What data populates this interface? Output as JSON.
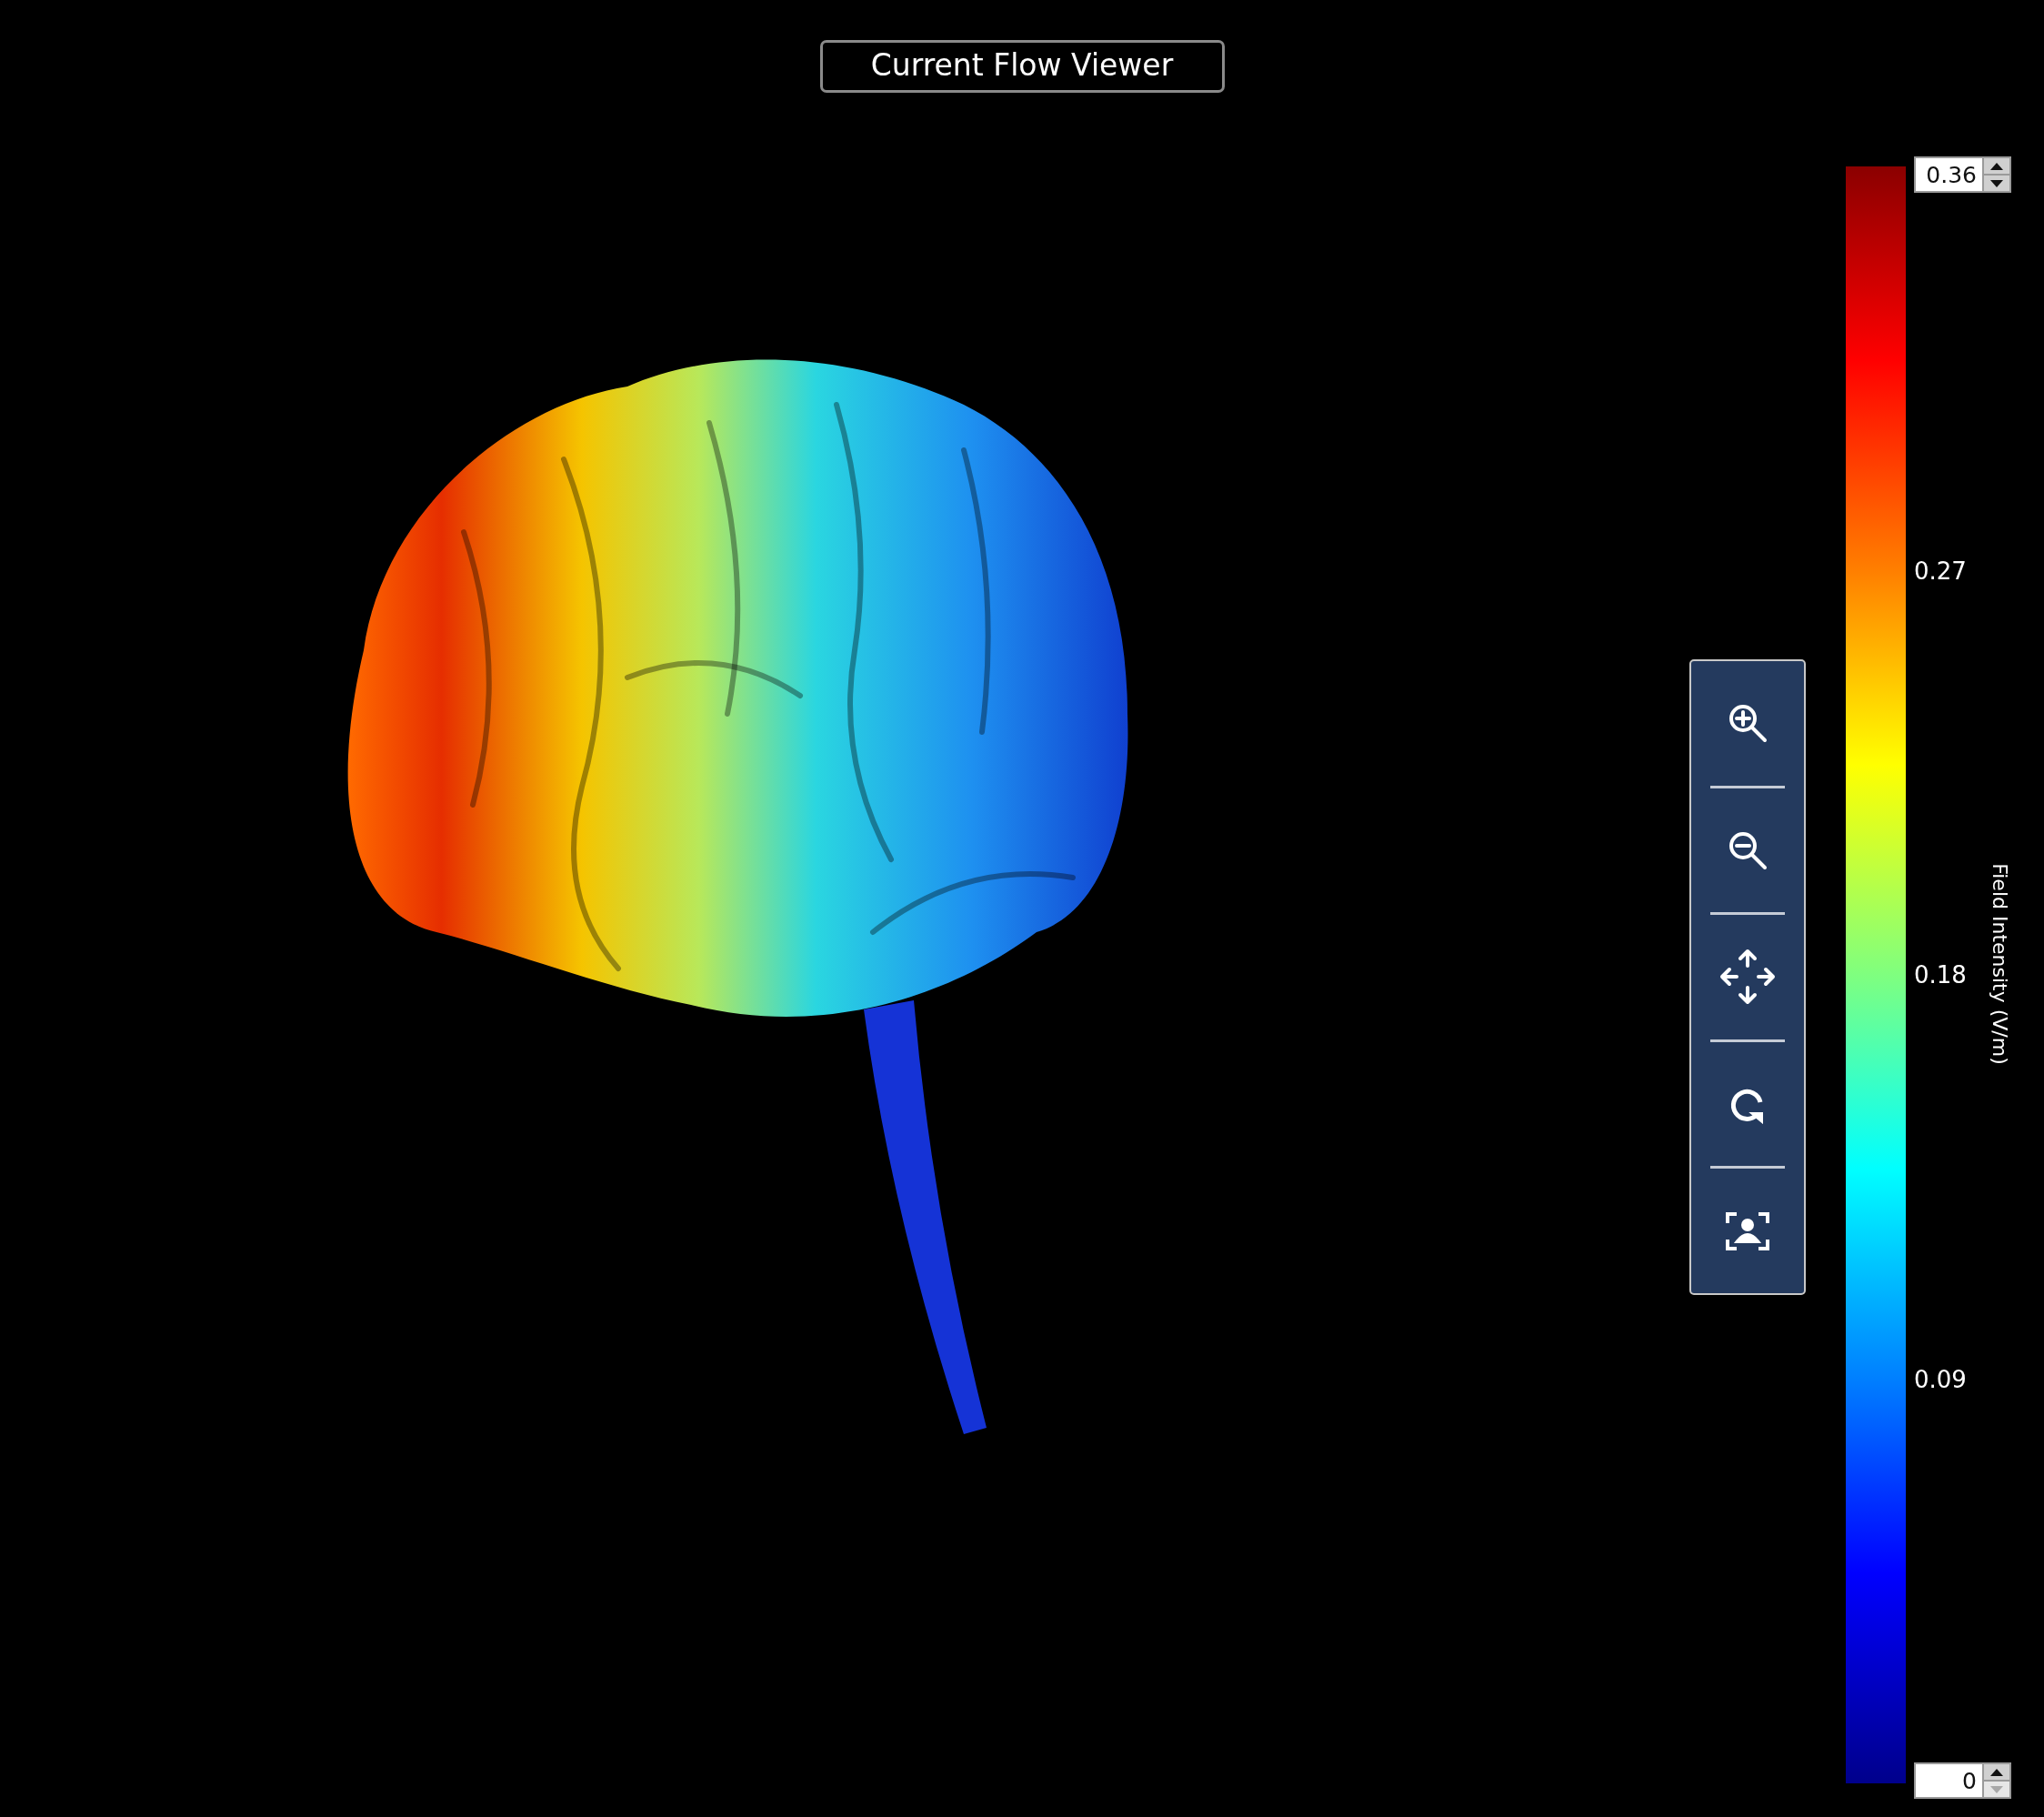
{
  "title": "Current Flow Viewer",
  "colorbar": {
    "title": "Field Intensity (V/m)",
    "ticks": [
      "0.27",
      "0.18",
      "0.09"
    ],
    "max_field": {
      "value": "0.36",
      "up_disabled": false,
      "down_disabled": false
    },
    "min_field": {
      "value": "0",
      "up_disabled": false,
      "down_disabled": true
    }
  }
}
